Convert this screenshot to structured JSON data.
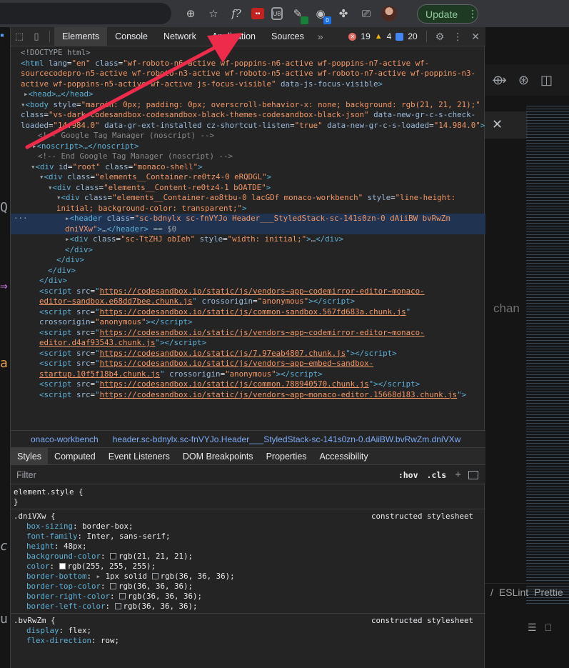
{
  "browser": {
    "update_label": "Update",
    "update_menu": "⋮",
    "ext_badge_blue": "0"
  },
  "background": {
    "right_text": "chan",
    "status_eslint": "ESLint",
    "status_prettier": "Prettie"
  },
  "devtools": {
    "tabs": [
      "Elements",
      "Console",
      "Network",
      "Application",
      "Sources"
    ],
    "more_tabs": "»",
    "errors": "19",
    "warnings": "4",
    "info": "20",
    "tree": {
      "doctype": "<!DOCTYPE html>",
      "html_open_a": "<html ",
      "html_lang_attr": "lang",
      "html_lang_val": "\"en\"",
      "html_class_attr": "class",
      "html_class_val": "\"wf-roboto-n6-active wf-poppins-n6-active wf-poppins-n7-active wf-sourcecodepro-n5-active wf-roboto-n3-active wf-roboto-n5-active wf-roboto-n7-active wf-poppins-n3-active wf-poppins-n5-active wf-active js-focus-visible\"",
      "html_data_attr": "data-js-focus-visible",
      "head": "<head>…</head>",
      "body_style_val": "\"margin: 0px; padding: 0px; overscroll-behavior-x: none; background: rgb(21, 21, 21);\"",
      "body_class_val": "\"vs-dark codesandbox-codesandbox-black-themes-codesandbox-black-json\"",
      "body_gr_attr": "data-new-gr-c-s-check-loaded",
      "body_gr_val": "\"14.984.0\"",
      "body_ext_attr": "data-gr-ext-installed",
      "body_cz_attr": "cz-shortcut-listen",
      "body_cz_val": "\"true\"",
      "body_gr2_attr": "data-new-gr-c-s-loaded",
      "body_gr2_val": "\"14.984.0\"",
      "comment1": "<!-- Google Tag Manager (noscript) -->",
      "noscript": "<noscript>…</noscript>",
      "comment2": "<!-- End Google Tag Manager (noscript) -->",
      "root_id": "\"root\"",
      "root_class": "\"monaco-shell\"",
      "container_class": "\"elements__Container-re0tz4-0 eRQDGL\"",
      "content_class": "\"elements__Content-re0tz4-1 bOATDE\"",
      "workbench_class": "\"elements__Container-ao8tbu-0 lacGDf monaco-workbench\"",
      "workbench_style": "\"line-height: initial; background-color: transparent;\"",
      "header_class": "\"sc-bdnylx sc-fnVYJo Header___StyledStack-sc-141s0zn-0 dAiiBW bvRwZm dniVXw\"",
      "header_eq": "== $0",
      "div_class": "\"sc-TtZHJ obIeh\"",
      "div_style": "\"width: initial;\"",
      "scripts": [
        {
          "src": "https://codesandbox.io/static/js/vendors~app~codemirror-editor~monaco-editor~sandbox.e68dd7bee.chunk.js",
          "cross": "\"anonymous\""
        },
        {
          "src": "https://codesandbox.io/static/js/common-sandbox.567fd683a.chunk.js",
          "cross": "\"anonymous\""
        },
        {
          "src": "https://codesandbox.io/static/js/vendors~app~codemirror-editor~monaco-editor.d4af93543.chunk.js",
          "cross": ""
        },
        {
          "src": "https://codesandbox.io/static/js/7.97eab4807.chunk.js",
          "cross": ""
        },
        {
          "src": "https://codesandbox.io/static/js/vendors~app~embed~sandbox-startup.10f5f18b4.chunk.js",
          "cross": "\"anonymous\""
        },
        {
          "src": "https://codesandbox.io/static/js/common.788940570.chunk.js",
          "cross": ""
        },
        {
          "src": "https://codesandbox.io/static/js/vendors~app~monaco-editor.15668d183.chunk.js",
          "cross": ""
        }
      ]
    },
    "breadcrumbs": [
      "onaco-workbench",
      "header.sc-bdnylx.sc-fnVYJo.Header___StyledStack-sc-141s0zn-0.dAiiBW.bvRwZm.dniVXw"
    ],
    "sub_tabs": [
      "Styles",
      "Computed",
      "Event Listeners",
      "DOM Breakpoints",
      "Properties",
      "Accessibility"
    ],
    "filter_placeholder": "Filter",
    "hov": ":hov",
    "cls": ".cls",
    "styles": {
      "element_style": "element.style {",
      "close": "}",
      "rule1_selector": ".dniVXw {",
      "rule1_source": "constructed stylesheet",
      "rule1": [
        {
          "p": "box-sizing",
          "v": "border-box;"
        },
        {
          "p": "font-family",
          "v": "Inter, sans-serif;"
        },
        {
          "p": "height",
          "v": "48px;"
        },
        {
          "p": "background-color",
          "v": "rgb(21, 21, 21);",
          "sw": "#151515"
        },
        {
          "p": "color",
          "v": "rgb(255, 255, 255);",
          "sw": "#ffffff"
        },
        {
          "p": "border-bottom",
          "v": "1px solid ",
          "v2": "rgb(36, 36, 36);",
          "sw": "#242424",
          "expand": true
        },
        {
          "p": "border-top-color",
          "v": "rgb(36, 36, 36);",
          "sw": "#242424"
        },
        {
          "p": "border-right-color",
          "v": "rgb(36, 36, 36);",
          "sw": "#242424"
        },
        {
          "p": "border-left-color",
          "v": "rgb(36, 36, 36);",
          "sw": "#242424"
        }
      ],
      "rule2_selector": ".bvRwZm {",
      "rule2_source": "constructed stylesheet",
      "rule2": [
        {
          "p": "display",
          "v": "flex;"
        },
        {
          "p": "flex-direction",
          "v": "row;"
        }
      ]
    }
  },
  "colors": {
    "tag": "#5db0d7",
    "attr_name": "#9bbbdc",
    "attr_value": "#f29766",
    "arrow": "#ee2b4b"
  }
}
